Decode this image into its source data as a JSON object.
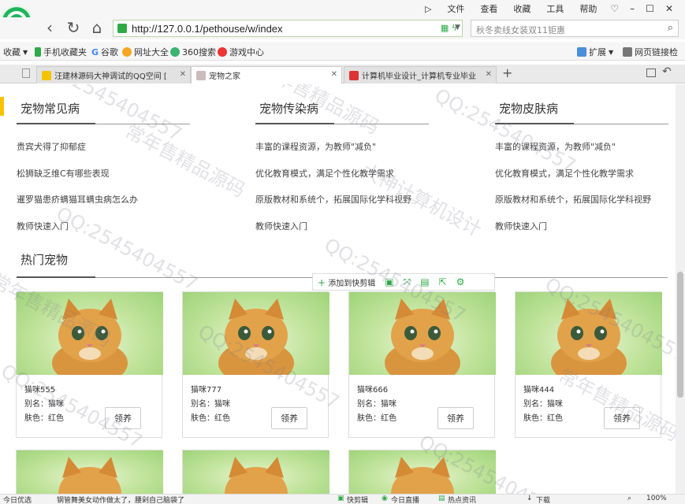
{
  "menu": {
    "items": [
      "文件",
      "查看",
      "收藏",
      "工具",
      "帮助"
    ]
  },
  "nav": {
    "url": "http://127.0.0.1/pethouse/w/index",
    "search_placeholder": "秋冬卖线女装双11钜惠"
  },
  "bookmarks": [
    {
      "label": "收藏",
      "icon": "star-icon"
    },
    {
      "label": "手机收藏夹",
      "icon": "phone-icon"
    },
    {
      "label": "谷歌",
      "icon": "google-icon"
    },
    {
      "label": "网址大全",
      "icon": "globe-icon"
    },
    {
      "label": "360搜索",
      "icon": "search-icon"
    },
    {
      "label": "游戏中心",
      "icon": "game-icon"
    },
    {
      "label": "扩展",
      "icon": "grid-icon"
    },
    {
      "label": "网页链接检",
      "icon": "link-icon"
    }
  ],
  "tabs": [
    {
      "label": "汪建林源码大神调试的QQ空间 [",
      "active": false
    },
    {
      "label": "宠物之家",
      "active": true
    },
    {
      "label": "计算机毕业设计_计算机专业毕业",
      "active": false
    }
  ],
  "sections": [
    {
      "title": "宠物常见病",
      "items": [
        "贵宾犬得了抑郁症",
        "松狮缺乏维C有哪些表现",
        "暹罗猫患疥螨猫耳螨虫病怎么办",
        "教师快速入门"
      ]
    },
    {
      "title": "宠物传染病",
      "items": [
        "丰富的课程资源，为教师\"减负\"",
        "优化教育模式，满足个性化教学需求",
        "原版教材和系统个，拓展国际化学科视野",
        "教师快速入门"
      ]
    },
    {
      "title": "宠物皮肤病",
      "items": [
        "丰富的课程资源，为教师\"减负\"",
        "优化教育模式，满足个性化教学需求",
        "原版教材和系统个，拓展国际化学科视野",
        "教师快速入门"
      ]
    }
  ],
  "hot": {
    "title": "热门宠物",
    "adopt_label": "领养",
    "pets": [
      {
        "name": "猫咪555",
        "alias": "别名：猫咪",
        "color": "肤色：红色"
      },
      {
        "name": "猫咪777",
        "alias": "别名：猫咪",
        "color": "肤色：红色"
      },
      {
        "name": "猫咪666",
        "alias": "别名：猫咪",
        "color": "肤色：红色"
      },
      {
        "name": "猫咪444",
        "alias": "别名：猫咪",
        "color": "肤色：红色"
      }
    ]
  },
  "float_toolbar": {
    "label": "添加到快剪辑"
  },
  "status": {
    "left": "今日优选",
    "news": "钢管舞美女动作做太了，腰剁自己脑袋了",
    "quick_clip": "快剪辑",
    "live": "今日直播",
    "hot_news": "热点资讯",
    "download": "下载",
    "zoom": "100%"
  },
  "watermark": {
    "qq": "QQ:2545404557",
    "text1": "常年售精品源码",
    "text2": "大神计算机设计"
  },
  "colors": {
    "accent": "#2faa47",
    "yellow_marker": "#f5c400"
  }
}
